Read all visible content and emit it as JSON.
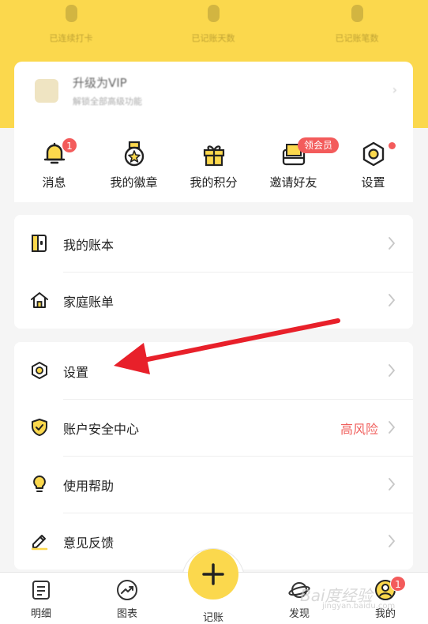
{
  "header": {
    "stats": [
      {
        "label": "已连续打卡"
      },
      {
        "label": "已记账天数"
      },
      {
        "label": "已记账笔数"
      }
    ],
    "vip": {
      "title": "升级为VIP",
      "subtitle": "解锁全部高级功能"
    }
  },
  "quick_actions": [
    {
      "label": "消息",
      "icon": "bell-icon",
      "badge": "1"
    },
    {
      "label": "我的徽章",
      "icon": "medal-icon"
    },
    {
      "label": "我的积分",
      "icon": "gift-icon"
    },
    {
      "label": "邀请好友",
      "icon": "invite-icon",
      "badge": "领会员"
    },
    {
      "label": "设置",
      "icon": "hexagon-settings-icon",
      "dot": true
    }
  ],
  "card1": [
    {
      "label": "我的账本",
      "icon": "ledger-icon"
    },
    {
      "label": "家庭账单",
      "icon": "home-icon"
    }
  ],
  "card2": [
    {
      "label": "设置",
      "icon": "hexagon-settings-icon"
    },
    {
      "label": "账户安全中心",
      "icon": "shield-check-icon",
      "extra": "高风险"
    },
    {
      "label": "使用帮助",
      "icon": "lightbulb-icon"
    },
    {
      "label": "意见反馈",
      "icon": "pencil-icon"
    }
  ],
  "nav": [
    {
      "label": "明细",
      "icon": "list-icon"
    },
    {
      "label": "图表",
      "icon": "chart-icon"
    },
    {
      "label": "记账",
      "icon": "plus-icon"
    },
    {
      "label": "发现",
      "icon": "planet-icon"
    },
    {
      "label": "我的",
      "icon": "profile-icon",
      "badge": "1"
    }
  ],
  "colors": {
    "accent": "#fbd84d",
    "alert": "#f35b5b",
    "risk_text": "#f0605d",
    "annotation_arrow": "#e8202a"
  },
  "watermark": {
    "text": "Bai度经验",
    "sub": "jingyan.baidu.com"
  }
}
